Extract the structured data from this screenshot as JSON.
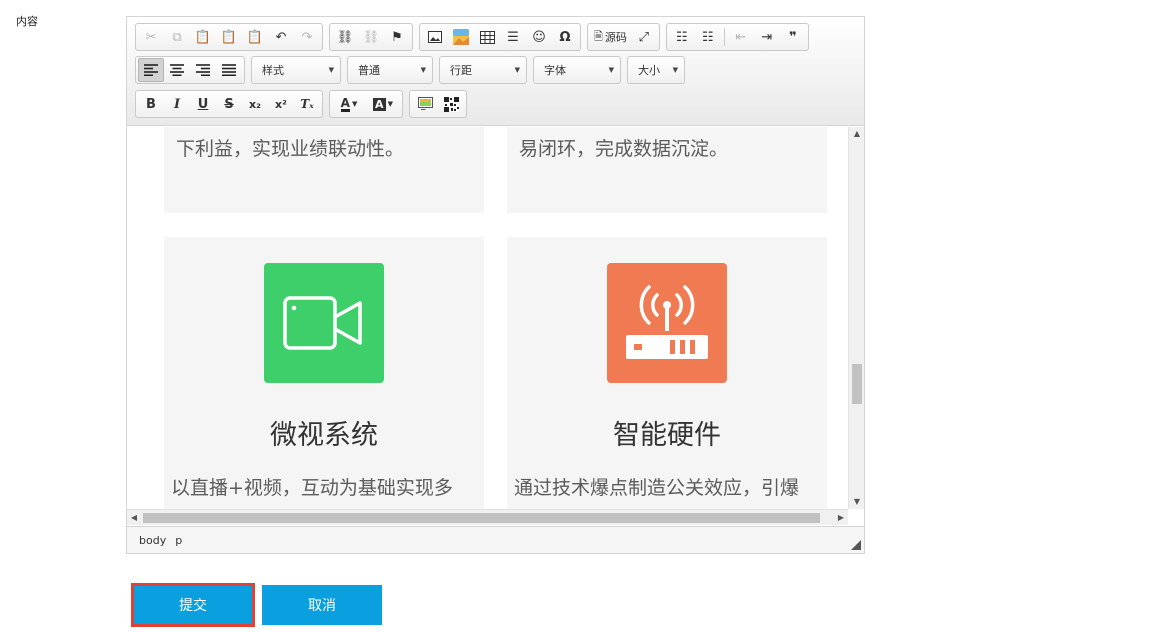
{
  "form": {
    "content_label": "内容",
    "submit_label": "提交",
    "cancel_label": "取消"
  },
  "toolbar": {
    "source_label": "源码",
    "dropdowns": {
      "style": "样式",
      "paragraph": "普通",
      "line_height": "行距",
      "font_family": "字体",
      "font_size": "大小"
    },
    "icons_row1": [
      "cut-icon",
      "copy-icon",
      "paste-icon",
      "paste-text-icon",
      "paste-word-icon",
      "undo-icon",
      "redo-icon",
      "link-icon",
      "unlink-icon",
      "anchor-flag-icon",
      "image-icon",
      "flash-icon",
      "table-icon",
      "horizontal-rule-icon",
      "emoticon-icon",
      "special-char-icon",
      "source-icon",
      "maximize-icon",
      "ordered-list-icon",
      "unordered-list-icon",
      "outdent-icon",
      "indent-icon",
      "blockquote-icon"
    ],
    "icons_row3": [
      "bold-icon",
      "italic-icon",
      "underline-icon",
      "strike-icon",
      "subscript-icon",
      "superscript-icon",
      "remove-format-icon",
      "font-color-icon",
      "bg-color-icon",
      "multi-image-icon",
      "qrcode-icon"
    ]
  },
  "content": {
    "card_top_left_text": "下利益，实现业绩联动性。",
    "card_top_right_text": "易闭环，完成数据沉淀。",
    "card_video": {
      "title": "微视系统",
      "text": "以直播+视频，互动为基础实现多",
      "icon": "video-camera-icon",
      "color": "#3ecf6a"
    },
    "card_hardware": {
      "title": "智能硬件",
      "text": "通过技术爆点制造公关效应，引爆",
      "icon": "router-icon",
      "color": "#f07a52"
    }
  },
  "statusbar": {
    "path": [
      "body",
      "p"
    ]
  }
}
